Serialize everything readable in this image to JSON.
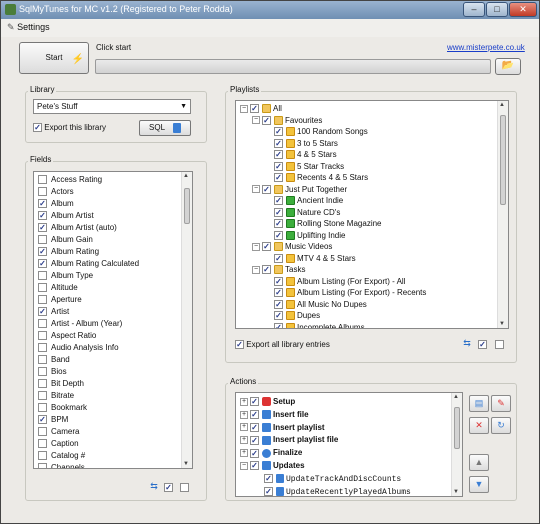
{
  "window": {
    "title": "SqlMyTunes for MC v1.2 (Registered to Peter Rodda)",
    "minimize": "–",
    "maximize": "□",
    "close": "✕"
  },
  "menu": {
    "settings": "Settings"
  },
  "toolbar": {
    "start_label": "Start",
    "status_label": "Click start",
    "website_link": "www.misterpete.co.uk"
  },
  "library": {
    "group_label": "Library",
    "selected": "Pete's Stuff",
    "export_label": "Export this library",
    "export_checked": true,
    "sql_button": "SQL"
  },
  "fields": {
    "group_label": "Fields",
    "items": [
      {
        "label": "Access Rating",
        "checked": false
      },
      {
        "label": "Actors",
        "checked": false
      },
      {
        "label": "Album",
        "checked": true
      },
      {
        "label": "Album Artist",
        "checked": true
      },
      {
        "label": "Album Artist (auto)",
        "checked": true
      },
      {
        "label": "Album Gain",
        "checked": false
      },
      {
        "label": "Album Rating",
        "checked": true
      },
      {
        "label": "Album Rating Calculated",
        "checked": true
      },
      {
        "label": "Album Type",
        "checked": false
      },
      {
        "label": "Altitude",
        "checked": false
      },
      {
        "label": "Aperture",
        "checked": false
      },
      {
        "label": "Artist",
        "checked": true
      },
      {
        "label": "Artist - Album (Year)",
        "checked": false
      },
      {
        "label": "Aspect Ratio",
        "checked": false
      },
      {
        "label": "Audio Analysis Info",
        "checked": false
      },
      {
        "label": "Band",
        "checked": false
      },
      {
        "label": "Bios",
        "checked": false
      },
      {
        "label": "Bit Depth",
        "checked": false
      },
      {
        "label": "Bitrate",
        "checked": false
      },
      {
        "label": "Bookmark",
        "checked": false
      },
      {
        "label": "BPM",
        "checked": true
      },
      {
        "label": "Camera",
        "checked": false
      },
      {
        "label": "Caption",
        "checked": false
      },
      {
        "label": "Catalog #",
        "checked": false
      },
      {
        "label": "Channels",
        "checked": false
      }
    ]
  },
  "playlists": {
    "group_label": "Playlists",
    "export_all_label": "Export all library entries",
    "export_all_checked": true,
    "tree": [
      {
        "label": "All",
        "level": 0,
        "type": "folder",
        "expander": "−"
      },
      {
        "label": "Favourites",
        "level": 1,
        "type": "folder",
        "expander": "−"
      },
      {
        "label": "100 Random Songs",
        "level": 2,
        "type": "playlist"
      },
      {
        "label": "3 to 5 Stars",
        "level": 2,
        "type": "playlist"
      },
      {
        "label": "4 & 5 Stars",
        "level": 2,
        "type": "playlist"
      },
      {
        "label": "5 Star Tracks",
        "level": 2,
        "type": "playlist"
      },
      {
        "label": "Recents 4 & 5 Stars",
        "level": 2,
        "type": "playlist"
      },
      {
        "label": "Just Put Together",
        "level": 1,
        "type": "folder",
        "expander": "−"
      },
      {
        "label": "Ancient Indie",
        "level": 2,
        "type": "play"
      },
      {
        "label": "Nature CD's",
        "level": 2,
        "type": "play"
      },
      {
        "label": "Rolling Stone Magazine",
        "level": 2,
        "type": "play"
      },
      {
        "label": "Uplifting Indie",
        "level": 2,
        "type": "play"
      },
      {
        "label": "Music Videos",
        "level": 1,
        "type": "folder",
        "expander": "−"
      },
      {
        "label": "MTV 4 & 5 Stars",
        "level": 2,
        "type": "playlist"
      },
      {
        "label": "Tasks",
        "level": 1,
        "type": "folder",
        "expander": "−"
      },
      {
        "label": "Album Listing (For Export) - All",
        "level": 2,
        "type": "playlist"
      },
      {
        "label": "Album Listing (For Export) - Recents",
        "level": 2,
        "type": "playlist"
      },
      {
        "label": "All Music No Dupes",
        "level": 2,
        "type": "playlist"
      },
      {
        "label": "Dupes",
        "level": 2,
        "type": "playlist"
      },
      {
        "label": "Incomplete Albums",
        "level": 2,
        "type": "playlist"
      }
    ]
  },
  "actions": {
    "group_label": "Actions",
    "items": [
      {
        "label": "Setup",
        "level": 0,
        "icon": "set",
        "expander": "+",
        "bold": true
      },
      {
        "label": "Insert file",
        "level": 0,
        "icon": "ins",
        "expander": "+",
        "bold": true
      },
      {
        "label": "Insert playlist",
        "level": 0,
        "icon": "ins",
        "expander": "+",
        "bold": true
      },
      {
        "label": "Insert playlist file",
        "level": 0,
        "icon": "ins",
        "expander": "+",
        "bold": true
      },
      {
        "label": "Finalize",
        "level": 0,
        "icon": "fin",
        "expander": "+",
        "bold": true
      },
      {
        "label": "Updates",
        "level": 0,
        "icon": "ins",
        "expander": "−",
        "bold": true
      },
      {
        "label": "UpdateTrackAndDiscCounts",
        "level": 1,
        "icon": "dbs",
        "mono": true
      },
      {
        "label": "UpdateRecentlyPlayedAlbums",
        "level": 1,
        "icon": "dbs",
        "mono": true
      }
    ]
  },
  "icons": {
    "refresh": "⇆",
    "up": "▲",
    "down": "▼",
    "folder": "📂",
    "bolt": "⚡"
  },
  "colors": {
    "title_bar": "#7f9bbf",
    "link": "#1a3ec8",
    "checkmark": "#2a3c8a"
  }
}
